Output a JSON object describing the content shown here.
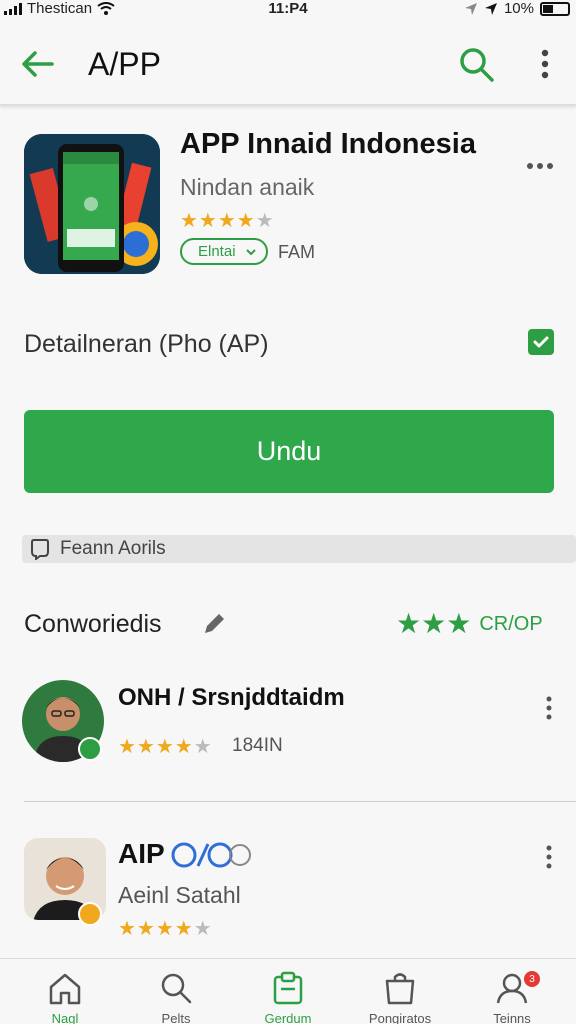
{
  "status_bar": {
    "carrier": "Thestican",
    "time": "11:P4",
    "battery": "10%"
  },
  "app_bar": {
    "title": "A/PP",
    "back_icon": "arrow-left-icon",
    "search_icon": "search-icon",
    "more_icon": "more-vertical-icon"
  },
  "app": {
    "name": "APP Innaid Indonesia",
    "developer": "Nindan anaik",
    "rating_stars": 4,
    "rating_max": 5,
    "pill_label": "Elntai",
    "time_label": "FAM"
  },
  "detail": {
    "label": "Detailneran  (Pho (AP)",
    "checked": true
  },
  "download_button": {
    "label": "Undu"
  },
  "banner": {
    "text": "Feann Aorils",
    "icon": "bookmark-icon"
  },
  "section": {
    "title": "Conworiedis",
    "rating_label": "CR/OP",
    "rating_stars": 3,
    "edit_icon": "pencil-icon"
  },
  "reviews": [
    {
      "name": "ONH / Srsnjddtaidm",
      "subtitle": "",
      "rating_stars": 4,
      "meta": "184IN"
    },
    {
      "name": "AIP",
      "subtitle": "Aeinl Satahl",
      "rating_stars": 4,
      "meta": ""
    }
  ],
  "bottom_nav": [
    {
      "label": "Nagl",
      "icon": "home-icon",
      "active": true
    },
    {
      "label": "Pelts",
      "icon": "search-icon",
      "active": false
    },
    {
      "label": "Gerdum",
      "icon": "clipboard-icon",
      "active": false
    },
    {
      "label": "Pongiratos",
      "icon": "shopping-bag-icon",
      "active": false
    },
    {
      "label": "Teinns",
      "icon": "profile-icon",
      "active": false,
      "badge": "3"
    }
  ],
  "colors": {
    "accent_green": "#2ea84a",
    "star_gold": "#f0a81c",
    "badge_red": "#e53935"
  }
}
